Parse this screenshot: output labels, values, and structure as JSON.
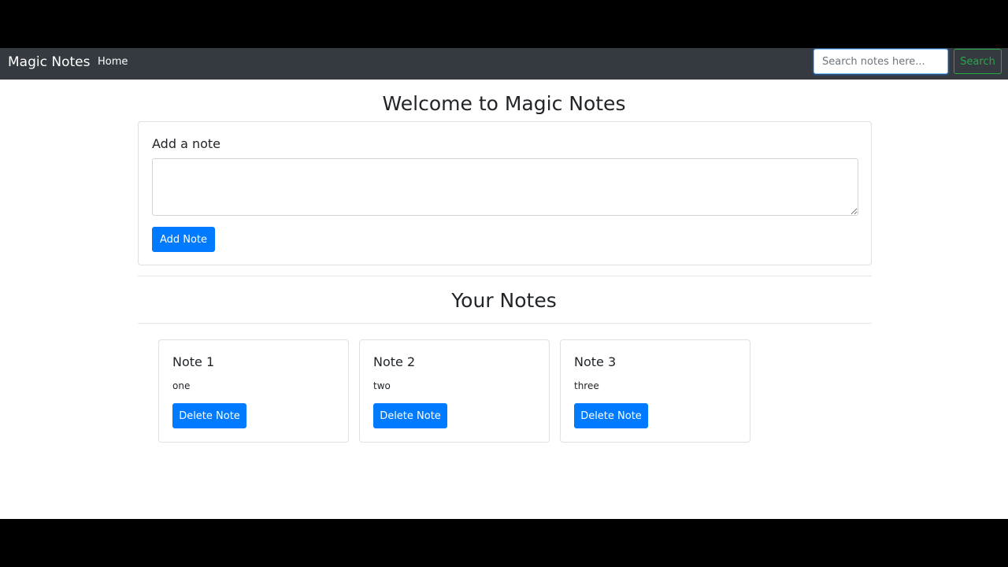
{
  "navbar": {
    "brand": "Magic Notes",
    "home_label": "Home",
    "search_placeholder": "Search notes here...",
    "search_label": "Search"
  },
  "main": {
    "welcome_title": "Welcome to Magic Notes",
    "add_card_title": "Add a note",
    "textarea_value": "",
    "add_button_label": "Add Note",
    "notes_heading": "Your Notes"
  },
  "notes": [
    {
      "title": "Note 1",
      "text": "one",
      "delete_label": "Delete Note"
    },
    {
      "title": "Note 2",
      "text": "two",
      "delete_label": "Delete Note"
    },
    {
      "title": "Note 3",
      "text": "three",
      "delete_label": "Delete Note"
    }
  ],
  "colors": {
    "navbar_bg": "#343a40",
    "primary": "#007bff",
    "success": "#28a745",
    "letterbox": "#000000"
  }
}
